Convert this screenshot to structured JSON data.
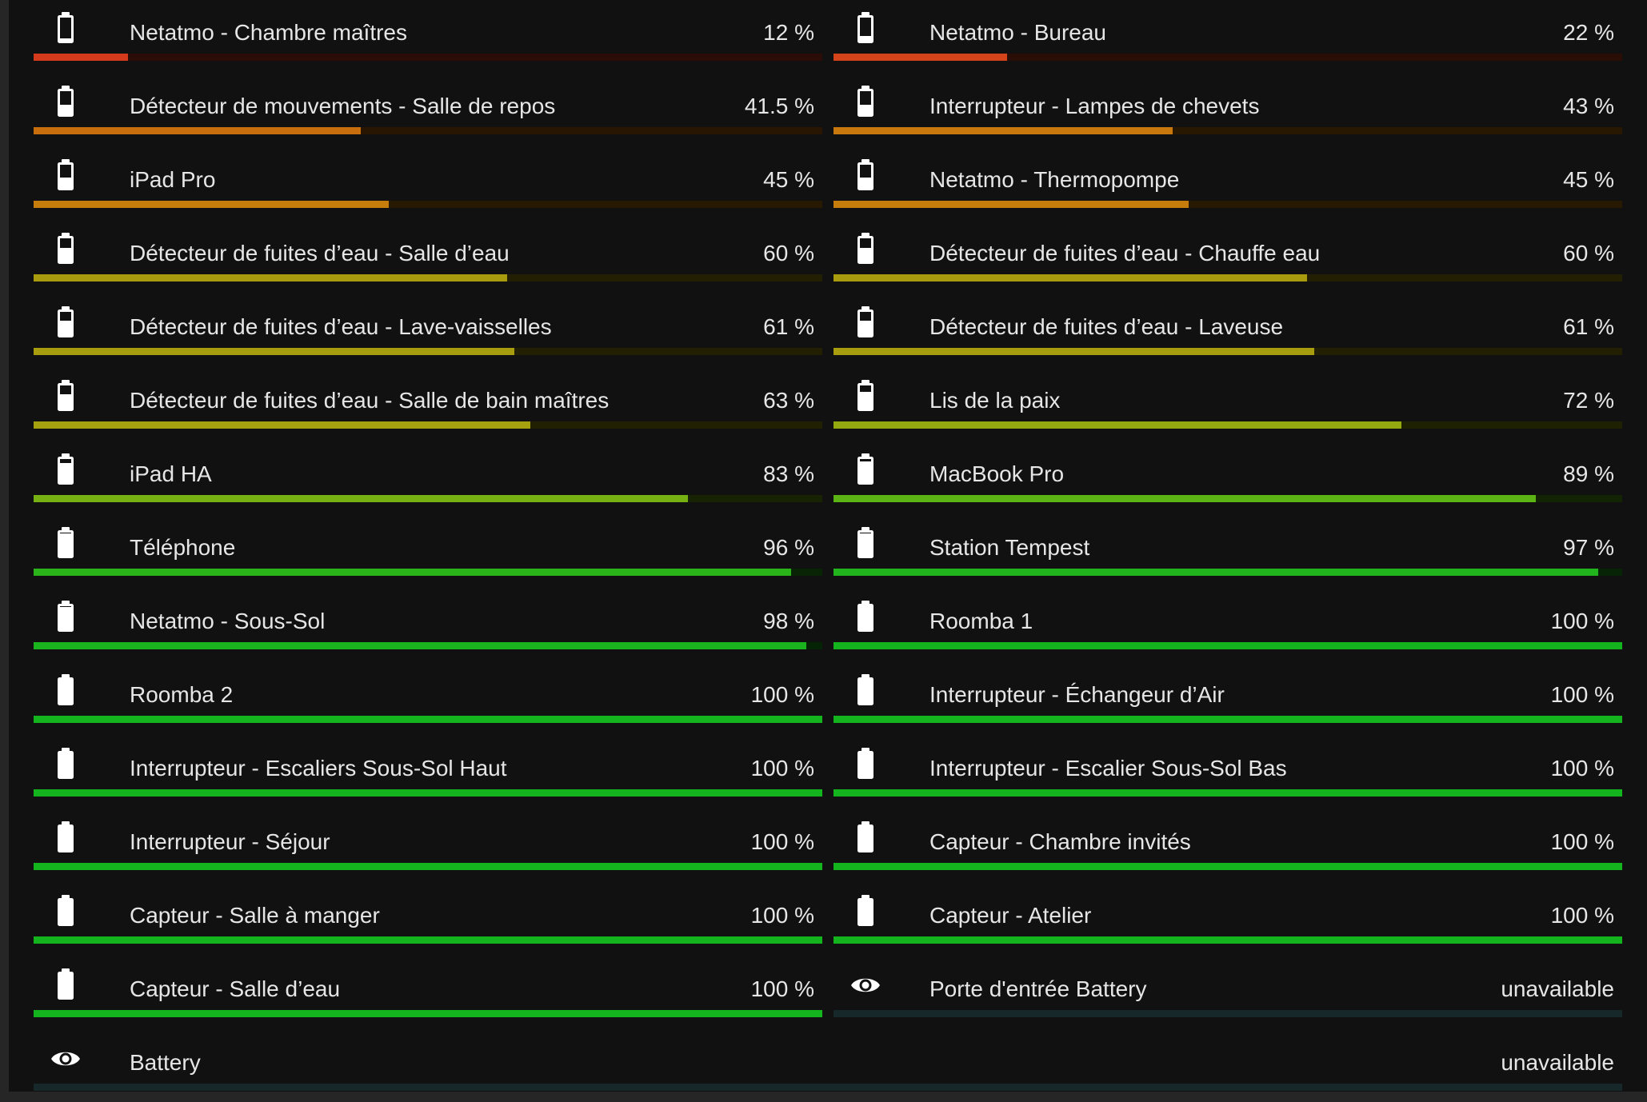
{
  "left_column": [
    {
      "name": "Netatmo - Chambre maîtres",
      "value": "12 %",
      "level": 12,
      "icon": "battery-icon"
    },
    {
      "name": "Détecteur de mouvements - Salle de repos",
      "value": "41.5 %",
      "level": 41.5,
      "icon": "battery-icon"
    },
    {
      "name": "iPad Pro",
      "value": "45 %",
      "level": 45,
      "icon": "battery-icon"
    },
    {
      "name": "Détecteur de fuites d’eau - Salle d’eau",
      "value": "60 %",
      "level": 60,
      "icon": "battery-icon"
    },
    {
      "name": "Détecteur de fuites d’eau - Lave-vaisselles",
      "value": "61 %",
      "level": 61,
      "icon": "battery-icon"
    },
    {
      "name": "Détecteur de fuites d’eau - Salle de bain maîtres",
      "value": "63 %",
      "level": 63,
      "icon": "battery-icon"
    },
    {
      "name": "iPad HA",
      "value": "83 %",
      "level": 83,
      "icon": "battery-icon"
    },
    {
      "name": "Téléphone",
      "value": "96 %",
      "level": 96,
      "icon": "battery-icon"
    },
    {
      "name": "Netatmo - Sous-Sol",
      "value": "98 %",
      "level": 98,
      "icon": "battery-icon"
    },
    {
      "name": "Roomba 2",
      "value": "100 %",
      "level": 100,
      "icon": "battery-icon"
    },
    {
      "name": "Interrupteur - Escaliers Sous-Sol Haut",
      "value": "100 %",
      "level": 100,
      "icon": "battery-icon"
    },
    {
      "name": "Interrupteur - Séjour",
      "value": "100 %",
      "level": 100,
      "icon": "battery-icon"
    },
    {
      "name": "Capteur - Salle à manger",
      "value": "100 %",
      "level": 100,
      "icon": "battery-icon"
    },
    {
      "name": "Capteur - Salle d’eau",
      "value": "100 %",
      "level": 100,
      "icon": "battery-icon"
    }
  ],
  "right_column": [
    {
      "name": "Netatmo - Bureau",
      "value": "22 %",
      "level": 22,
      "icon": "battery-icon"
    },
    {
      "name": "Interrupteur - Lampes de chevets",
      "value": "43 %",
      "level": 43,
      "icon": "battery-icon"
    },
    {
      "name": "Netatmo - Thermopompe",
      "value": "45 %",
      "level": 45,
      "icon": "battery-icon"
    },
    {
      "name": "Détecteur de fuites d’eau - Chauffe eau",
      "value": "60 %",
      "level": 60,
      "icon": "battery-icon"
    },
    {
      "name": "Détecteur de fuites d’eau - Laveuse",
      "value": "61 %",
      "level": 61,
      "icon": "battery-icon"
    },
    {
      "name": "Lis de la paix",
      "value": "72 %",
      "level": 72,
      "icon": "battery-icon"
    },
    {
      "name": "MacBook Pro",
      "value": "89 %",
      "level": 89,
      "icon": "battery-icon"
    },
    {
      "name": "Station Tempest",
      "value": "97 %",
      "level": 97,
      "icon": "battery-icon"
    },
    {
      "name": "Roomba 1",
      "value": "100 %",
      "level": 100,
      "icon": "battery-icon"
    },
    {
      "name": "Interrupteur - Échangeur d’Air",
      "value": "100 %",
      "level": 100,
      "icon": "battery-icon"
    },
    {
      "name": "Interrupteur - Escalier Sous-Sol Bas",
      "value": "100 %",
      "level": 100,
      "icon": "battery-icon"
    },
    {
      "name": "Capteur - Chambre invités",
      "value": "100 %",
      "level": 100,
      "icon": "battery-icon"
    },
    {
      "name": "Capteur - Atelier",
      "value": "100 %",
      "level": 100,
      "icon": "battery-icon"
    },
    {
      "name": "Porte d'entrée Battery",
      "value": "unavailable",
      "level": null,
      "icon": "eye-icon"
    }
  ],
  "full_width": [
    {
      "name": "Battery",
      "value": "unavailable",
      "level": null,
      "icon": "eye-icon"
    }
  ],
  "colors": {
    "panel_background": "#111111",
    "page_background": "#262626",
    "text": "#e6e6e6",
    "icon": "#ffffff",
    "unavailable_track": "#16282a",
    "level_12": "#d63a1c",
    "level_22": "#d4431a",
    "level_41_5": "#c86e0c",
    "level_43": "#c8780c",
    "level_45": "#c67d0c",
    "level_60": "#a89b0e",
    "level_61": "#a89d0e",
    "level_63": "#a6a20f",
    "level_72": "#94a810",
    "level_83": "#76b012",
    "level_89": "#5cb414",
    "level_96": "#2ab41a",
    "level_97": "#22b41c",
    "level_98": "#1ab41e",
    "level_100": "#14b41e"
  }
}
